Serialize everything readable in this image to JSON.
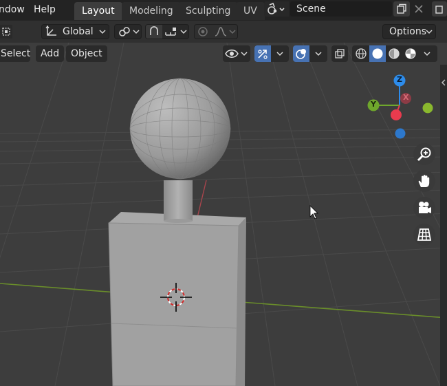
{
  "menubar": {
    "items": [
      "ndow",
      "Help"
    ],
    "workspace_tabs": [
      "Layout",
      "Modeling",
      "Sculpting",
      "UV"
    ],
    "active_tab": "Layout",
    "scene_name": "Scene"
  },
  "tool_header": {
    "orientation_label": "Global",
    "options_label": "Options"
  },
  "viewport_header": {
    "menus": [
      "Select",
      "Add",
      "Object"
    ]
  },
  "gizmo": {
    "z_label": "Z",
    "y_label": "Y",
    "x_label": "X",
    "colors": {
      "x": "#e83b4e",
      "y": "#6fa72c",
      "z": "#2d8ceb",
      "neg_y": "#8ab82e"
    }
  },
  "icons": [
    "scene-icon",
    "copy-icon",
    "close-icon",
    "transform-icon",
    "link-icon",
    "snap-icon",
    "snap-increment-icon",
    "proportional-icon",
    "falloff-icon",
    "visibility-icon",
    "gizmo-icon",
    "overlay-icon",
    "xray-icon",
    "wireframe-icon",
    "solid-icon",
    "material-icon",
    "rendered-icon",
    "zoom-icon",
    "hand-icon",
    "camera-icon",
    "grid-icon"
  ]
}
